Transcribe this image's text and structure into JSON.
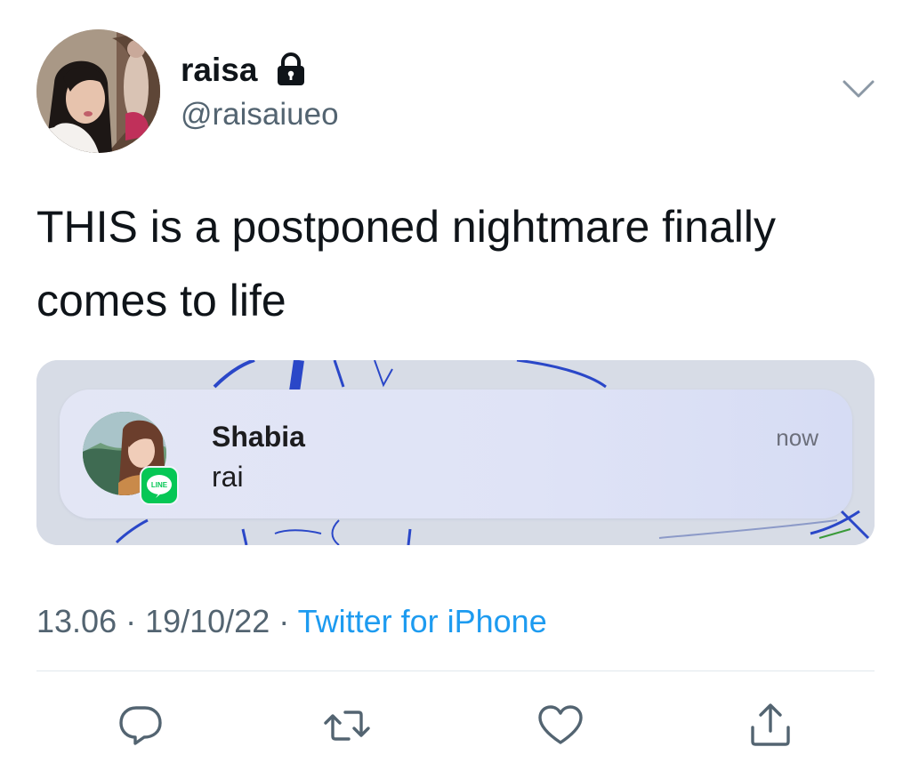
{
  "tweet": {
    "display_name": "raisa",
    "handle": "@raisaiueo",
    "text": "THIS is a postponed nightmare finally comes to life",
    "timestamp": "13.06 · 19/10/22",
    "separator": "·",
    "source": "Twitter for iPhone"
  },
  "notification": {
    "sender": "Shabia",
    "message": "rai",
    "time": "now",
    "app_badge": "LINE"
  },
  "icons": {
    "protected": "lock-icon",
    "menu": "chevron-down-icon",
    "reply": "reply-icon",
    "retweet": "retweet-icon",
    "like": "heart-icon",
    "share": "share-icon",
    "app": "line-icon"
  },
  "colors": {
    "link": "#1d9bf0",
    "secondary_text": "#536471",
    "line_green": "#06c755",
    "icon_gray": "#536471"
  }
}
